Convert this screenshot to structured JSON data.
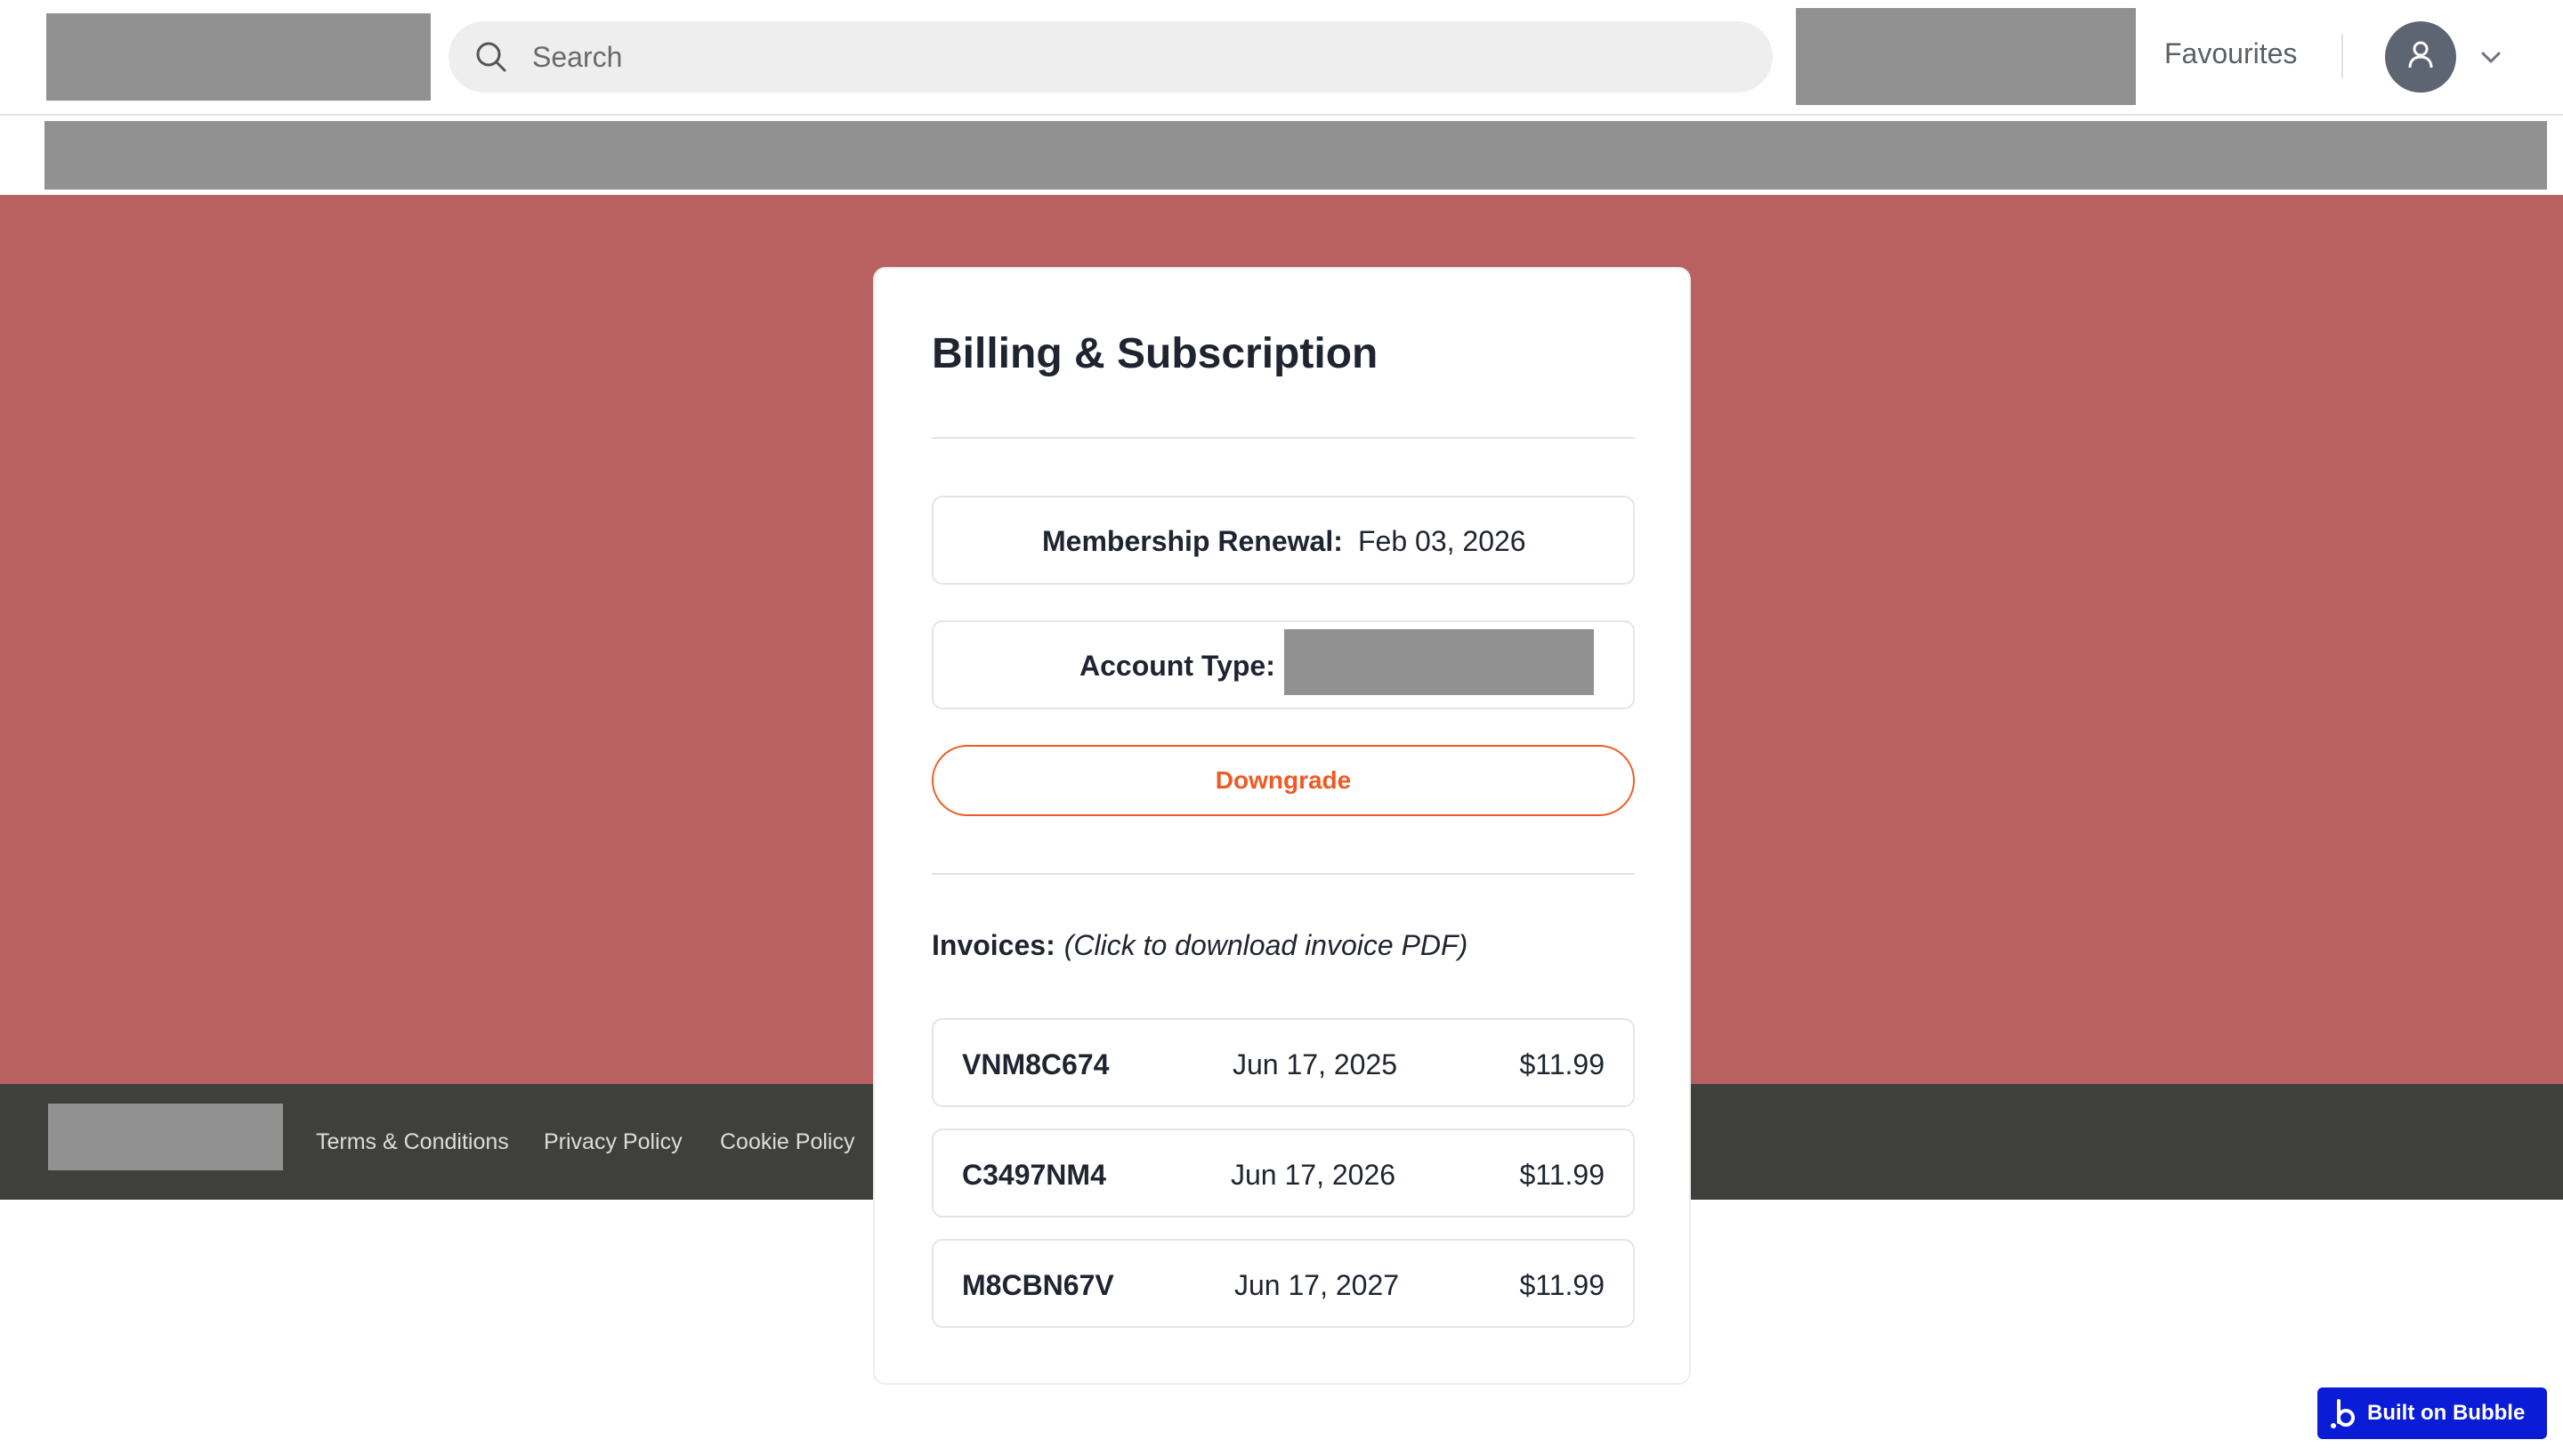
{
  "header": {
    "search_placeholder": "Search",
    "favourites_label": "Favourites",
    "icons": {
      "search": "search-icon",
      "user": "user-icon",
      "chevron": "chevron-down-icon"
    }
  },
  "billing": {
    "title": "Billing & Subscription",
    "membership_renewal_label": "Membership Renewal:",
    "membership_renewal_value": "Feb 03, 2026",
    "account_type_label": "Account Type:",
    "downgrade_label": "Downgrade",
    "invoices_label": "Invoices:",
    "invoices_hint": "(Click to download invoice PDF)",
    "invoices": [
      {
        "id": "VNM8C674",
        "date": "Jun 17, 2025",
        "amount": "$11.99"
      },
      {
        "id": "C3497NM4",
        "date": "Jun 17, 2026",
        "amount": "$11.99"
      },
      {
        "id": "M8CBN67V",
        "date": "Jun 17, 2027",
        "amount": "$11.99"
      }
    ]
  },
  "footer": {
    "links": [
      "Terms & Conditions",
      "Privacy Policy",
      "Cookie Policy"
    ]
  },
  "badge": {
    "label": "Built on Bubble",
    "icon": "bubble-logo-icon"
  },
  "colors": {
    "hero_bg": "#b86160",
    "footer_bg": "#3f3f3c",
    "accent": "#f05a22",
    "badge_bg": "#0b1cd6",
    "redacted": "#919191"
  }
}
